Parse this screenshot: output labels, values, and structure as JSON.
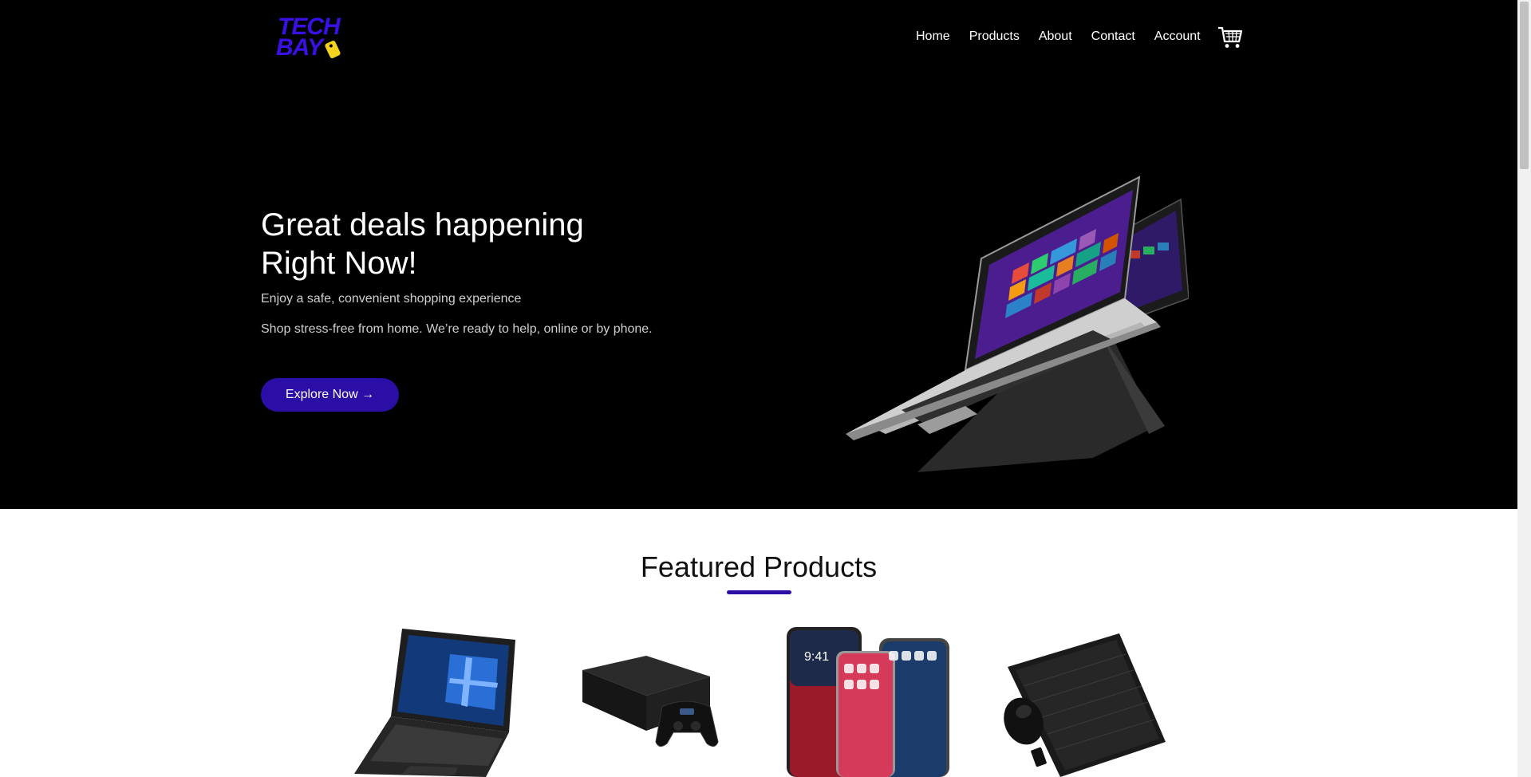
{
  "brand": {
    "line1": "TECH",
    "line2": "BAY"
  },
  "nav": {
    "items": [
      {
        "label": "Home"
      },
      {
        "label": "Products"
      },
      {
        "label": "About"
      },
      {
        "label": "Contact"
      },
      {
        "label": "Account"
      }
    ],
    "cart_icon": "shopping-cart-icon"
  },
  "hero": {
    "title_line1": "Great deals happening",
    "title_line2": "Right Now!",
    "subtitle": "Enjoy a safe, convenient shopping experience",
    "description": "Shop stress-free from home. We’re ready to help, online or by phone.",
    "cta_label": "Explore Now →",
    "image": "convertible-laptop"
  },
  "featured": {
    "title": "Featured Products",
    "products": [
      {
        "image": "tablet-with-keyboard"
      },
      {
        "image": "game-console-with-controller"
      },
      {
        "image": "smartphones"
      },
      {
        "image": "keyboard-and-mouse"
      }
    ]
  },
  "colors": {
    "hero_background": "#000000",
    "accent": "#2a0ea5",
    "logo_blue": "#3a10e5",
    "logo_tag": "#f2d21e"
  }
}
